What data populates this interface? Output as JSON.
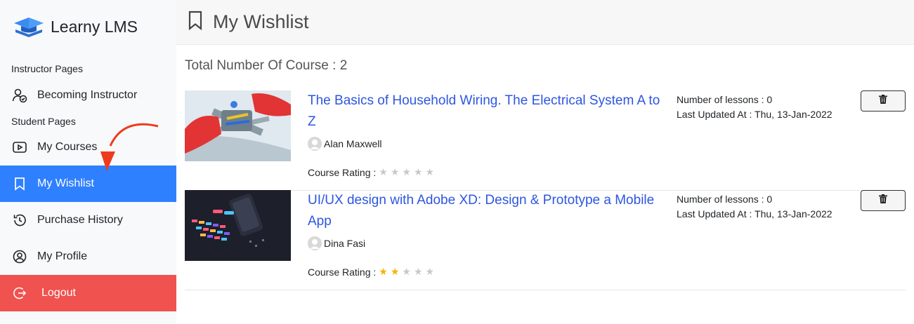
{
  "brand": {
    "name": "Learny LMS",
    "icon": "graduation-cap-icon"
  },
  "sidebar": {
    "sections": [
      {
        "title": "Instructor Pages"
      },
      {
        "title": "Student Pages"
      }
    ],
    "items": [
      {
        "label": "Becoming Instructor",
        "icon": "user-check-icon"
      },
      {
        "label": "My Courses",
        "icon": "play-square-icon"
      },
      {
        "label": "My Wishlist",
        "icon": "bookmark-icon",
        "active": true
      },
      {
        "label": "Purchase History",
        "icon": "history-icon"
      },
      {
        "label": "My Profile",
        "icon": "user-circle-icon"
      },
      {
        "label": "Logout",
        "icon": "logout-icon"
      }
    ]
  },
  "header": {
    "title": "My Wishlist",
    "icon": "bookmark-icon"
  },
  "main": {
    "total_label": "Total Number Of Course : 2",
    "courses": [
      {
        "title": "The Basics of Household Wiring. The Electrical System A to Z",
        "author": "Alan Maxwell",
        "rating_label": "Course Rating :",
        "rating": 0,
        "lessons": "Number of lessons : 0",
        "updated": "Last Updated At : Thu, 13-Jan-2022"
      },
      {
        "title": "UI/UX design with Adobe XD: Design & Prototype a Mobile App",
        "author": "Dina Fasi",
        "rating_label": "Course Rating :",
        "rating": 2,
        "lessons": "Number of lessons : 0",
        "updated": "Last Updated At : Thu, 13-Jan-2022"
      }
    ]
  },
  "colors": {
    "active": "#2f80ff",
    "logout": "#f0524f",
    "link": "#2d56e0",
    "star": "#f5b301",
    "arrow": "#ee3b1e"
  }
}
